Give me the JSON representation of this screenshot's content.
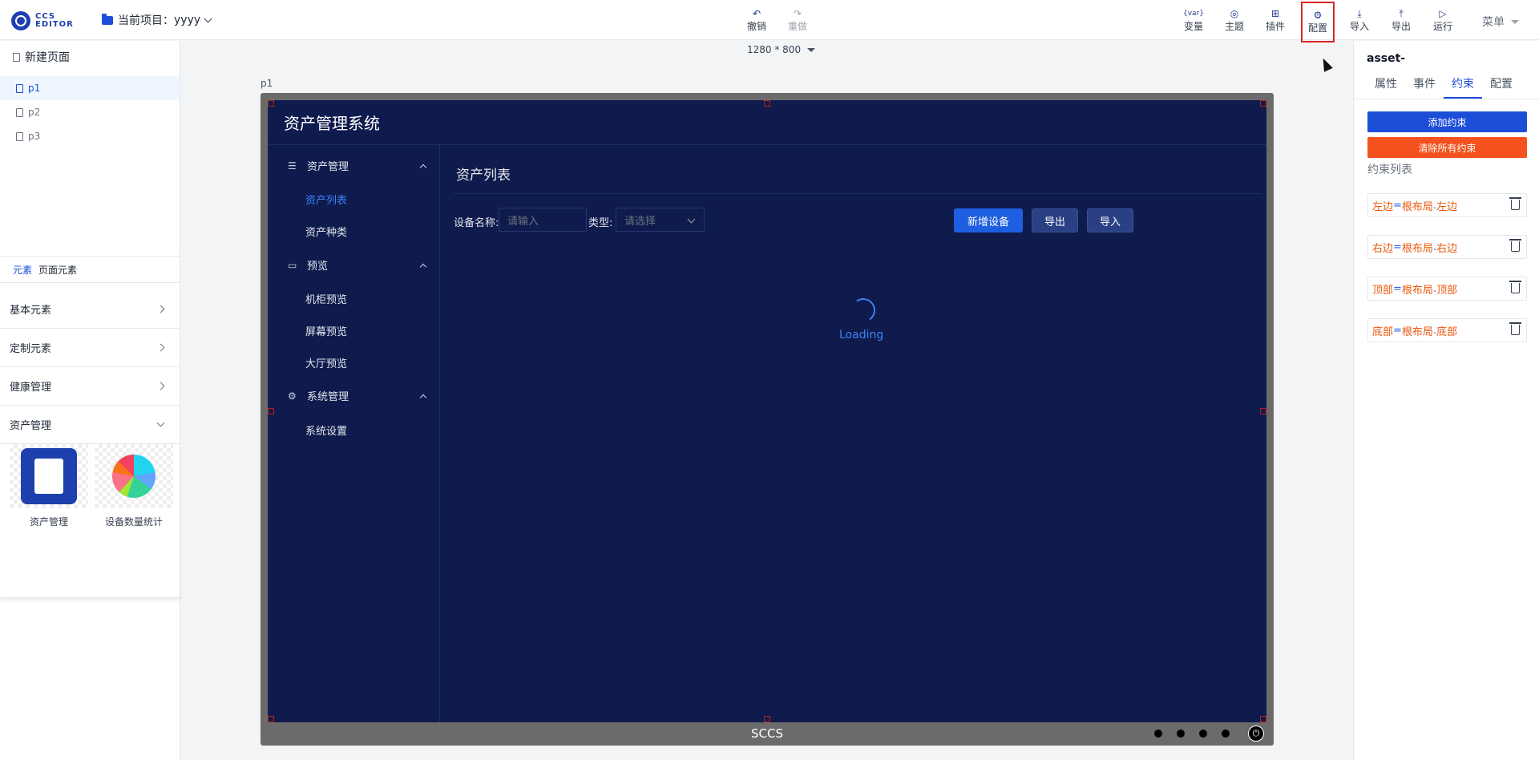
{
  "header": {
    "logo_line1": "CCS",
    "logo_line2": "EDITOR",
    "project_label": "当前项目：",
    "project_name": "yyyy",
    "toolbar": [
      {
        "label": "撤销",
        "icon": "undo-icon",
        "glyph": "↶",
        "disabled": false
      },
      {
        "label": "重做",
        "icon": "redo-icon",
        "glyph": "↷",
        "disabled": true
      }
    ],
    "right_tools": [
      {
        "label": "变量",
        "icon": "variable-icon",
        "glyph": "{var}"
      },
      {
        "label": "主题",
        "icon": "theme-icon",
        "glyph": "◎"
      },
      {
        "label": "插件",
        "icon": "plugin-icon",
        "glyph": "⊞"
      },
      {
        "label": "配置",
        "icon": "config-icon",
        "glyph": "⚙"
      },
      {
        "label": "导入",
        "icon": "import-icon",
        "glyph": "⤓"
      },
      {
        "label": "导出",
        "icon": "export-icon",
        "glyph": "⤒"
      },
      {
        "label": "运行",
        "icon": "run-icon",
        "glyph": "▷"
      }
    ],
    "menu_label": "菜单"
  },
  "left": {
    "new_page": "新建页面",
    "pages": [
      "p1",
      "p2",
      "p3"
    ],
    "active_page": "p1",
    "tabs": [
      "元素",
      "页面元素"
    ],
    "categories": [
      "基本元素",
      "定制元素",
      "健康管理",
      "资产管理"
    ],
    "assets": [
      "资产管理",
      "设备数量统计"
    ]
  },
  "canvas": {
    "resolution": "1280 * 800",
    "page_label": "p1",
    "app_title": "资产管理系统",
    "nav": {
      "group1": "资产管理",
      "item1": "资产列表",
      "item2": "资产种类",
      "group2": "预览",
      "item3": "机柜预览",
      "item4": "屏幕预览",
      "item5": "大厅预览",
      "group3": "系统管理",
      "item6": "系统设置"
    },
    "content_title": "资产列表",
    "filter": {
      "name_label": "设备名称:",
      "name_placeholder": "请输入",
      "type_label": "类型:",
      "type_placeholder": "请选择"
    },
    "buttons": {
      "add": "新增设备",
      "export": "导出",
      "import": "导入"
    },
    "loading": "Loading",
    "brand": "SCCS"
  },
  "right": {
    "component_name": "asset-",
    "tabs": [
      "属性",
      "事件",
      "约束",
      "配置"
    ],
    "active_tab": "约束",
    "add_constraint": "添加约束",
    "clear_constraints": "清除所有约束",
    "list_title": "约束列表",
    "constraints": [
      {
        "a": "左边",
        "eq": "=",
        "b": "根布局",
        "dot": ".",
        "c": "左边"
      },
      {
        "a": "右边",
        "eq": "=",
        "b": "根布局",
        "dot": ".",
        "c": "右边"
      },
      {
        "a": "顶部",
        "eq": "=",
        "b": "根布局",
        "dot": ".",
        "c": "顶部"
      },
      {
        "a": "底部",
        "eq": "=",
        "b": "根布局",
        "dot": ".",
        "c": "底部"
      }
    ]
  },
  "colors": {
    "accent": "#1d4ed8",
    "screen_bg": "#0f1b4d",
    "danger": "#f4511e",
    "highlight_border": "#dc2626"
  }
}
